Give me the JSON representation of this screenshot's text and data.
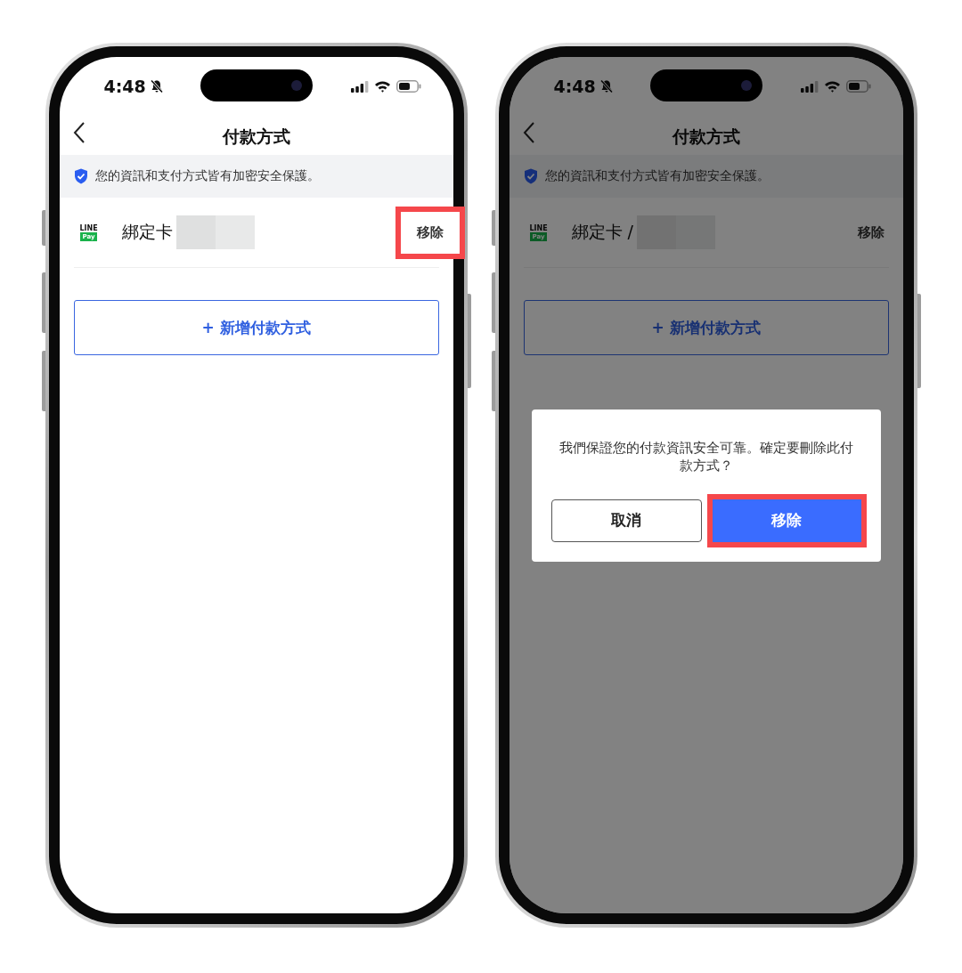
{
  "phones": [
    {
      "status_bar": {
        "time": "4:48"
      },
      "header": {
        "title": "付款方式"
      },
      "notice": "您的資訊和支付方式皆有加密安全保護。",
      "payment_methods": [
        {
          "logo_top": "LINE",
          "logo_badge": "Pay",
          "label": "綁定卡",
          "action": "移除",
          "highlighted": true
        }
      ],
      "add_button": "+ 新增付款方式"
    },
    {
      "status_bar": {
        "time": "4:48"
      },
      "header": {
        "title": "付款方式"
      },
      "notice": "您的資訊和支付方式皆有加密安全保護。",
      "payment_methods": [
        {
          "logo_top": "LINE",
          "logo_badge": "Pay",
          "label": "綁定卡 /",
          "action": "移除",
          "highlighted": false
        }
      ],
      "add_button": "+ 新增付款方式",
      "dialog": {
        "message": "我們保證您的付款資訊安全可靠。確定要刪除此付款方式？",
        "buttons": [
          {
            "label": "取消",
            "kind": "secondary",
            "highlighted": false
          },
          {
            "label": "移除",
            "kind": "primary",
            "highlighted": true
          }
        ]
      }
    }
  ]
}
